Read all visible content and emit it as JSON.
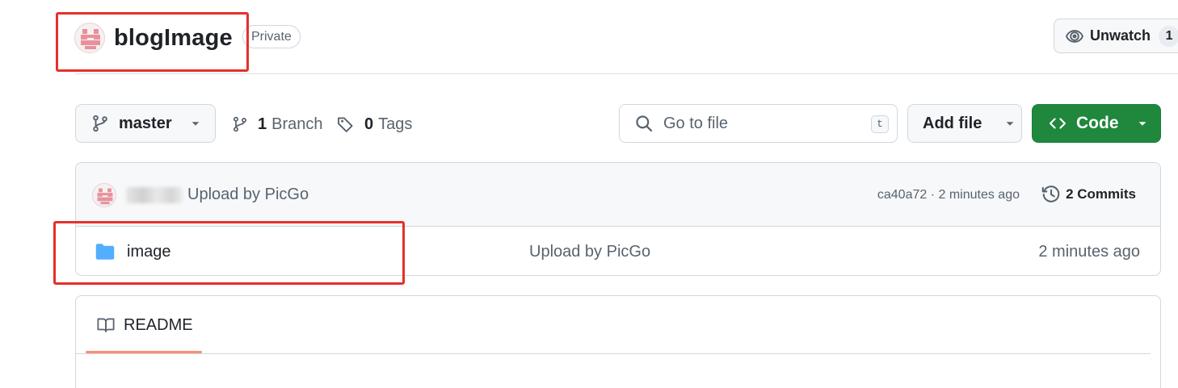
{
  "repo": {
    "name": "blogImage",
    "visibility": "Private"
  },
  "watch": {
    "label": "Unwatch",
    "count": "1"
  },
  "toolbar": {
    "branch_name": "master",
    "branches_count": "1",
    "branches_label": "Branch",
    "tags_count": "0",
    "tags_label": "Tags",
    "search_placeholder": "Go to file",
    "search_shortcut": "t",
    "add_file_label": "Add file",
    "code_label": "Code"
  },
  "latest_commit": {
    "message": "Upload by PicGo",
    "meta": "ca40a72 · 2 minutes ago",
    "commits_label": "2 Commits"
  },
  "files": [
    {
      "name": "image",
      "icon": "folder-icon",
      "commit_message": "Upload by PicGo",
      "age": "2 minutes ago"
    }
  ],
  "readme": {
    "tab_label": "README"
  },
  "colors": {
    "accent_green": "#1f883d",
    "folder_blue": "#54aeff",
    "readme_underline": "#fd8c73",
    "annotation_red": "#e5302c"
  }
}
